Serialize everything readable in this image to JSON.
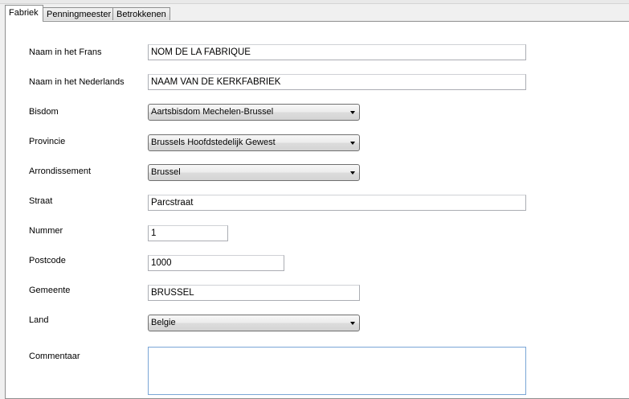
{
  "tabs": [
    {
      "label": "Fabriek",
      "active": true
    },
    {
      "label": "Penningmeester",
      "active": false
    },
    {
      "label": "Betrokkenen",
      "active": false
    }
  ],
  "form": {
    "naam_frans": {
      "label": "Naam in het Frans",
      "value": "NOM DE LA FABRIQUE"
    },
    "naam_nl": {
      "label": "Naam in het Nederlands",
      "value": "NAAM VAN DE KERKFABRIEK"
    },
    "bisdom": {
      "label": "Bisdom",
      "value": "Aartsbisdom  Mechelen-Brussel"
    },
    "provincie": {
      "label": "Provincie",
      "value": "Brussels Hoofdstedelijk Gewest"
    },
    "arrondissement": {
      "label": "Arrondissement",
      "value": "Brussel"
    },
    "straat": {
      "label": "Straat",
      "value": "Parcstraat"
    },
    "nummer": {
      "label": "Nummer",
      "value": "1"
    },
    "postcode": {
      "label": "Postcode",
      "value": "1000"
    },
    "gemeente": {
      "label": "Gemeente",
      "value": "BRUSSEL"
    },
    "land": {
      "label": "Land",
      "value": "Belgie"
    },
    "commentaar": {
      "label": "Commentaar",
      "value": ""
    }
  }
}
